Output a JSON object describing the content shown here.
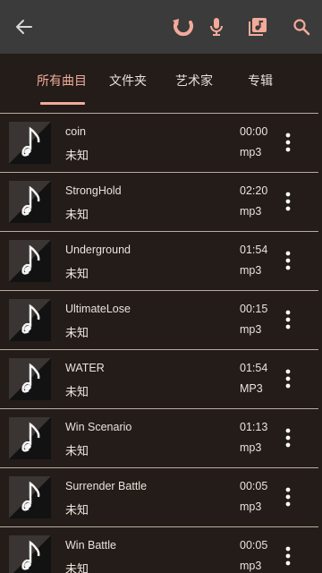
{
  "colors": {
    "accent": "#f3aa9a",
    "toolbar": "#3b3b3b",
    "background": "#231c18"
  },
  "toolbar": {
    "back_icon": "arrow-left-icon",
    "actions": [
      "refresh-icon",
      "microphone-icon",
      "music-library-icon",
      "search-icon"
    ]
  },
  "tabs": [
    {
      "label": "所有曲目",
      "active": true
    },
    {
      "label": "文件夹",
      "active": false
    },
    {
      "label": "艺术家",
      "active": false
    },
    {
      "label": "专辑",
      "active": false
    }
  ],
  "songs": [
    {
      "title": "coin",
      "artist": "未知",
      "duration": "00:00",
      "format": "mp3"
    },
    {
      "title": "StrongHold",
      "artist": "未知",
      "duration": "02:20",
      "format": "mp3"
    },
    {
      "title": "Underground",
      "artist": "未知",
      "duration": "01:54",
      "format": "mp3"
    },
    {
      "title": "UltimateLose",
      "artist": "未知",
      "duration": "00:15",
      "format": "mp3"
    },
    {
      "title": "WATER",
      "artist": "未知",
      "duration": "01:54",
      "format": "MP3"
    },
    {
      "title": "Win Scenario",
      "artist": "未知",
      "duration": "01:13",
      "format": "mp3"
    },
    {
      "title": "Surrender Battle",
      "artist": "未知",
      "duration": "00:05",
      "format": "mp3"
    },
    {
      "title": "Win Battle",
      "artist": "未知",
      "duration": "00:05",
      "format": "mp3"
    }
  ]
}
